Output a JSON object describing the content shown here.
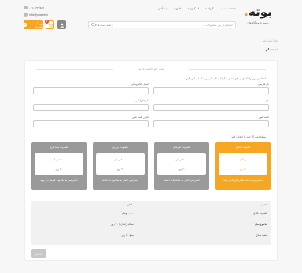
{
  "header": {
    "logo_text": "بوته",
    "tagline": "بوسته فروشگاه های",
    "contact": {
      "phone": "۰۲۱-۱۲۳۴۵۶۷",
      "email": "info@pooteh.ir"
    },
    "nav": [
      {
        "label": "صفحه نخست",
        "has_menu": false
      },
      {
        "label": "کیوان",
        "has_menu": true
      },
      {
        "label": "اسکیون",
        "has_menu": true
      },
      {
        "label": "هادی",
        "has_menu": true
      },
      {
        "label": "نیم آغاز",
        "has_menu": true
      }
    ],
    "search": {
      "placeholder": "جستجو در بین محصولات ...",
      "category": "همه دسته ها"
    },
    "cart_count": "0",
    "login_label": "ورود / عضویت",
    "login_icon_text": "+"
  },
  "breadcrumb": "خانه / ثبت نام",
  "page_title": "ثبت نام",
  "form": {
    "title": "ثبت نام اکانت جدید",
    "intro": "لطفا فرم زیر را تکمیل و برای عضویت آنرا ارسال نمایید و یا با ما تماس بگیرید.",
    "fields": {
      "first_name": "نام فارسی",
      "email": "ایمیل الکترونیکی",
      "last_name": "نام",
      "mobile": "نام خانوادگی",
      "password": "کلمه عبور",
      "password_repeat": "تکرار کلمه عبور"
    },
    "plans_label": "سطح اشتراک خود را انتخاب کنید",
    "plans": [
      {
        "title": "عضویت عادی",
        "price": "رایگان",
        "days": "۳۰ روز",
        "desc": "دسترسی به تمام بخش‌های کامل بوته",
        "active": true
      },
      {
        "title": "عضویت نقره‌ای",
        "price": "۵۰۰۰ تومان",
        "days": "۶۰ روز",
        "desc": "دسترسی کامل به محصولات داشته",
        "active": false
      },
      {
        "title": "عضویت برنزی",
        "price": "۸۰۰۰ تومان",
        "days": "۹۰ روز",
        "desc": "دسترسی کامل به محصولات داشته",
        "active": false
      },
      {
        "title": "عضویت ماندگاری",
        "price": "۱۵۰۰۰ تومان",
        "days": "۳۰ روز",
        "desc": "دسترسی به محدوده کیومان در بوته",
        "active": false
      }
    ],
    "summary": {
      "col_item": "عضویت",
      "col_amount": "مقدار",
      "rows": [
        {
          "label": "عضویت عادی",
          "value": "۰۰۰۰ تومان"
        },
        {
          "label": "مجموع مبلغ",
          "value": "نسخه رایگان / ۳۰ روز"
        },
        {
          "label": "تمدید بعدی",
          "value": "مبلغ ۳۰ روز"
        }
      ]
    },
    "submit_label": "ثبت نام"
  },
  "colors": {
    "accent": "#f5a623",
    "plan_inactive": "#9a9a9a",
    "badge": "#e74c3c"
  },
  "icons": {
    "cart": "cart-icon",
    "user": "user-icon",
    "search": "search-icon",
    "phone": "phone-icon",
    "email": "mail-icon"
  }
}
